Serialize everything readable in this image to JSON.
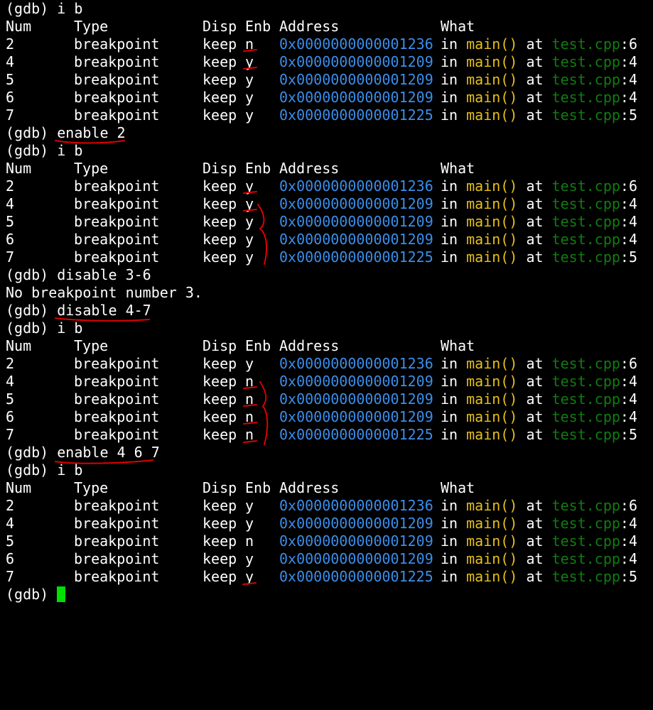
{
  "prompt": "(gdb)",
  "header": {
    "num": "Num",
    "type": "Type",
    "disp": "Disp",
    "enb": "Enb",
    "address": "Address",
    "what": "What"
  },
  "what_parts": {
    "in": "in",
    "at": "at"
  },
  "blocks": [
    {
      "command": "i b",
      "rows": [
        {
          "num": "2",
          "type": "breakpoint",
          "disp": "keep",
          "enb": "n",
          "address": "0x0000000000001236",
          "func": "main()",
          "file": "test.cpp",
          "line": ":6"
        },
        {
          "num": "4",
          "type": "breakpoint",
          "disp": "keep",
          "enb": "y",
          "address": "0x0000000000001209",
          "func": "main()",
          "file": "test.cpp",
          "line": ":4"
        },
        {
          "num": "5",
          "type": "breakpoint",
          "disp": "keep",
          "enb": "y",
          "address": "0x0000000000001209",
          "func": "main()",
          "file": "test.cpp",
          "line": ":4"
        },
        {
          "num": "6",
          "type": "breakpoint",
          "disp": "keep",
          "enb": "y",
          "address": "0x0000000000001209",
          "func": "main()",
          "file": "test.cpp",
          "line": ":4"
        },
        {
          "num": "7",
          "type": "breakpoint",
          "disp": "keep",
          "enb": "y",
          "address": "0x0000000000001225",
          "func": "main()",
          "file": "test.cpp",
          "line": ":5"
        }
      ]
    },
    {
      "pre_commands": [
        "enable 2"
      ],
      "command": "i b",
      "rows": [
        {
          "num": "2",
          "type": "breakpoint",
          "disp": "keep",
          "enb": "y",
          "address": "0x0000000000001236",
          "func": "main()",
          "file": "test.cpp",
          "line": ":6"
        },
        {
          "num": "4",
          "type": "breakpoint",
          "disp": "keep",
          "enb": "y",
          "address": "0x0000000000001209",
          "func": "main()",
          "file": "test.cpp",
          "line": ":4"
        },
        {
          "num": "5",
          "type": "breakpoint",
          "disp": "keep",
          "enb": "y",
          "address": "0x0000000000001209",
          "func": "main()",
          "file": "test.cpp",
          "line": ":4"
        },
        {
          "num": "6",
          "type": "breakpoint",
          "disp": "keep",
          "enb": "y",
          "address": "0x0000000000001209",
          "func": "main()",
          "file": "test.cpp",
          "line": ":4"
        },
        {
          "num": "7",
          "type": "breakpoint",
          "disp": "keep",
          "enb": "y",
          "address": "0x0000000000001225",
          "func": "main()",
          "file": "test.cpp",
          "line": ":5"
        }
      ]
    },
    {
      "pre_commands": [
        "disable 3-6"
      ],
      "message": "No breakpoint number 3.",
      "post_commands": [
        "disable 4-7"
      ],
      "command": "i b",
      "rows": [
        {
          "num": "2",
          "type": "breakpoint",
          "disp": "keep",
          "enb": "y",
          "address": "0x0000000000001236",
          "func": "main()",
          "file": "test.cpp",
          "line": ":6"
        },
        {
          "num": "4",
          "type": "breakpoint",
          "disp": "keep",
          "enb": "n",
          "address": "0x0000000000001209",
          "func": "main()",
          "file": "test.cpp",
          "line": ":4"
        },
        {
          "num": "5",
          "type": "breakpoint",
          "disp": "keep",
          "enb": "n",
          "address": "0x0000000000001209",
          "func": "main()",
          "file": "test.cpp",
          "line": ":4"
        },
        {
          "num": "6",
          "type": "breakpoint",
          "disp": "keep",
          "enb": "n",
          "address": "0x0000000000001209",
          "func": "main()",
          "file": "test.cpp",
          "line": ":4"
        },
        {
          "num": "7",
          "type": "breakpoint",
          "disp": "keep",
          "enb": "n",
          "address": "0x0000000000001225",
          "func": "main()",
          "file": "test.cpp",
          "line": ":5"
        }
      ]
    },
    {
      "pre_commands": [
        "enable 4 6 7"
      ],
      "command": "i b",
      "rows": [
        {
          "num": "2",
          "type": "breakpoint",
          "disp": "keep",
          "enb": "y",
          "address": "0x0000000000001236",
          "func": "main()",
          "file": "test.cpp",
          "line": ":6"
        },
        {
          "num": "4",
          "type": "breakpoint",
          "disp": "keep",
          "enb": "y",
          "address": "0x0000000000001209",
          "func": "main()",
          "file": "test.cpp",
          "line": ":4"
        },
        {
          "num": "5",
          "type": "breakpoint",
          "disp": "keep",
          "enb": "n",
          "address": "0x0000000000001209",
          "func": "main()",
          "file": "test.cpp",
          "line": ":4"
        },
        {
          "num": "6",
          "type": "breakpoint",
          "disp": "keep",
          "enb": "y",
          "address": "0x0000000000001209",
          "func": "main()",
          "file": "test.cpp",
          "line": ":4"
        },
        {
          "num": "7",
          "type": "breakpoint",
          "disp": "keep",
          "enb": "y",
          "address": "0x0000000000001225",
          "func": "main()",
          "file": "test.cpp",
          "line": ":5"
        }
      ]
    }
  ],
  "colors": {
    "background": "#000000",
    "text": "#ffffff",
    "address": "#3b8eea",
    "function": "#e5c01a",
    "file": "#0f7d0f",
    "cursor": "#00e000",
    "annotation": "#e00000"
  }
}
